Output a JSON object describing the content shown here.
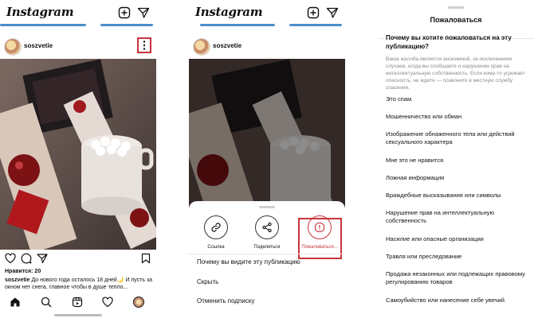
{
  "app": {
    "logo": "Instagram"
  },
  "post": {
    "username": "soszvetie",
    "likes": "Нравится: 20",
    "caption_user": "soszvetie",
    "caption_text": "До нового года осталось 18 дней🌙 И пусть за окном нет снега, главное чтобы в душе тепло..."
  },
  "options_sheet": {
    "share_items": [
      {
        "label": "Ссылка",
        "icon": "link-icon"
      },
      {
        "label": "Поделиться",
        "icon": "share-icon"
      },
      {
        "label": "Пожаловаться...",
        "icon": "report-icon"
      }
    ],
    "menu": [
      "Почему вы видите эту публикацию",
      "Скрыть",
      "Отменить подписку"
    ]
  },
  "report_dialog": {
    "title": "Пожаловаться",
    "question": "Почему вы хотите пожаловаться на эту публикацию?",
    "note": "Ваша жалоба является анонимной, за исключением случаев, когда вы сообщаете о нарушении прав на интеллектуальную собственность. Если кому-то угрожает опасность, не ждите — позвоните в местную службу спасения.",
    "reasons": [
      "Это спам",
      "Мошенничество или обман",
      "Изображение обнаженного тела или действий сексуального характера",
      "Мне это не нравится",
      "Ложная информация",
      "Враждебные высказывания или символы",
      "Нарушение прав на интеллектуальную собственность",
      "Насилие или опасные организации",
      "Травля или преследование",
      "Продажа незаконных или подлежащих правовому регулированию товаров",
      "Самоубийство или нанесение себе увечий"
    ]
  },
  "colors": {
    "highlight": "#c8343b",
    "story_bar": "#4a8ec9"
  },
  "icons": {
    "top": [
      "add-post-icon",
      "direct-message-icon"
    ],
    "actions": [
      "heart-icon",
      "comment-icon",
      "send-icon",
      "bookmark-icon"
    ],
    "nav": [
      "home-icon",
      "search-icon",
      "reels-icon",
      "activity-icon",
      "profile-avatar"
    ]
  }
}
